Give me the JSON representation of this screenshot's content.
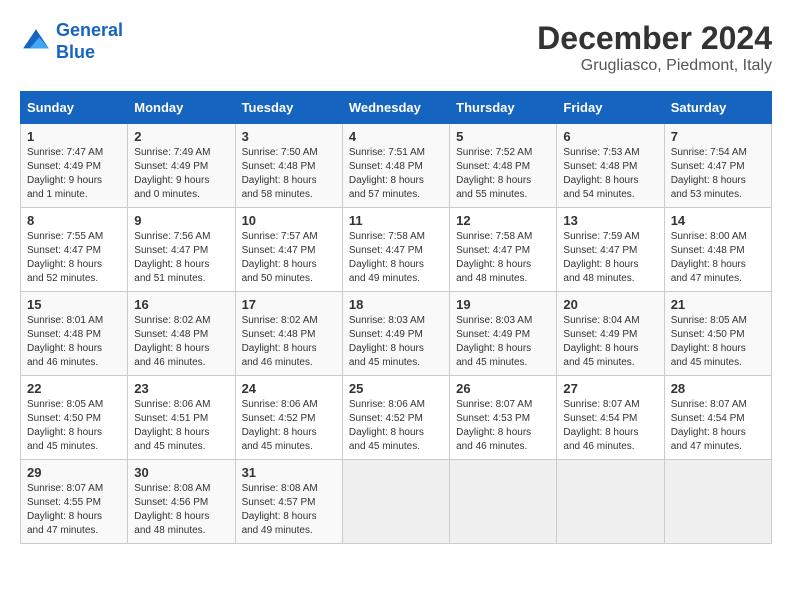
{
  "header": {
    "logo_line1": "General",
    "logo_line2": "Blue",
    "title": "December 2024",
    "subtitle": "Grugliasco, Piedmont, Italy"
  },
  "days_of_week": [
    "Sunday",
    "Monday",
    "Tuesday",
    "Wednesday",
    "Thursday",
    "Friday",
    "Saturday"
  ],
  "weeks": [
    [
      {
        "day": "1",
        "sunrise": "7:47 AM",
        "sunset": "4:49 PM",
        "daylight": "9 hours and 1 minute."
      },
      {
        "day": "2",
        "sunrise": "7:49 AM",
        "sunset": "4:49 PM",
        "daylight": "9 hours and 0 minutes."
      },
      {
        "day": "3",
        "sunrise": "7:50 AM",
        "sunset": "4:48 PM",
        "daylight": "8 hours and 58 minutes."
      },
      {
        "day": "4",
        "sunrise": "7:51 AM",
        "sunset": "4:48 PM",
        "daylight": "8 hours and 57 minutes."
      },
      {
        "day": "5",
        "sunrise": "7:52 AM",
        "sunset": "4:48 PM",
        "daylight": "8 hours and 55 minutes."
      },
      {
        "day": "6",
        "sunrise": "7:53 AM",
        "sunset": "4:48 PM",
        "daylight": "8 hours and 54 minutes."
      },
      {
        "day": "7",
        "sunrise": "7:54 AM",
        "sunset": "4:47 PM",
        "daylight": "8 hours and 53 minutes."
      }
    ],
    [
      {
        "day": "8",
        "sunrise": "7:55 AM",
        "sunset": "4:47 PM",
        "daylight": "8 hours and 52 minutes."
      },
      {
        "day": "9",
        "sunrise": "7:56 AM",
        "sunset": "4:47 PM",
        "daylight": "8 hours and 51 minutes."
      },
      {
        "day": "10",
        "sunrise": "7:57 AM",
        "sunset": "4:47 PM",
        "daylight": "8 hours and 50 minutes."
      },
      {
        "day": "11",
        "sunrise": "7:58 AM",
        "sunset": "4:47 PM",
        "daylight": "8 hours and 49 minutes."
      },
      {
        "day": "12",
        "sunrise": "7:58 AM",
        "sunset": "4:47 PM",
        "daylight": "8 hours and 48 minutes."
      },
      {
        "day": "13",
        "sunrise": "7:59 AM",
        "sunset": "4:47 PM",
        "daylight": "8 hours and 48 minutes."
      },
      {
        "day": "14",
        "sunrise": "8:00 AM",
        "sunset": "4:48 PM",
        "daylight": "8 hours and 47 minutes."
      }
    ],
    [
      {
        "day": "15",
        "sunrise": "8:01 AM",
        "sunset": "4:48 PM",
        "daylight": "8 hours and 46 minutes."
      },
      {
        "day": "16",
        "sunrise": "8:02 AM",
        "sunset": "4:48 PM",
        "daylight": "8 hours and 46 minutes."
      },
      {
        "day": "17",
        "sunrise": "8:02 AM",
        "sunset": "4:48 PM",
        "daylight": "8 hours and 46 minutes."
      },
      {
        "day": "18",
        "sunrise": "8:03 AM",
        "sunset": "4:49 PM",
        "daylight": "8 hours and 45 minutes."
      },
      {
        "day": "19",
        "sunrise": "8:03 AM",
        "sunset": "4:49 PM",
        "daylight": "8 hours and 45 minutes."
      },
      {
        "day": "20",
        "sunrise": "8:04 AM",
        "sunset": "4:49 PM",
        "daylight": "8 hours and 45 minutes."
      },
      {
        "day": "21",
        "sunrise": "8:05 AM",
        "sunset": "4:50 PM",
        "daylight": "8 hours and 45 minutes."
      }
    ],
    [
      {
        "day": "22",
        "sunrise": "8:05 AM",
        "sunset": "4:50 PM",
        "daylight": "8 hours and 45 minutes."
      },
      {
        "day": "23",
        "sunrise": "8:06 AM",
        "sunset": "4:51 PM",
        "daylight": "8 hours and 45 minutes."
      },
      {
        "day": "24",
        "sunrise": "8:06 AM",
        "sunset": "4:52 PM",
        "daylight": "8 hours and 45 minutes."
      },
      {
        "day": "25",
        "sunrise": "8:06 AM",
        "sunset": "4:52 PM",
        "daylight": "8 hours and 45 minutes."
      },
      {
        "day": "26",
        "sunrise": "8:07 AM",
        "sunset": "4:53 PM",
        "daylight": "8 hours and 46 minutes."
      },
      {
        "day": "27",
        "sunrise": "8:07 AM",
        "sunset": "4:54 PM",
        "daylight": "8 hours and 46 minutes."
      },
      {
        "day": "28",
        "sunrise": "8:07 AM",
        "sunset": "4:54 PM",
        "daylight": "8 hours and 47 minutes."
      }
    ],
    [
      {
        "day": "29",
        "sunrise": "8:07 AM",
        "sunset": "4:55 PM",
        "daylight": "8 hours and 47 minutes."
      },
      {
        "day": "30",
        "sunrise": "8:08 AM",
        "sunset": "4:56 PM",
        "daylight": "8 hours and 48 minutes."
      },
      {
        "day": "31",
        "sunrise": "8:08 AM",
        "sunset": "4:57 PM",
        "daylight": "8 hours and 49 minutes."
      },
      null,
      null,
      null,
      null
    ]
  ]
}
